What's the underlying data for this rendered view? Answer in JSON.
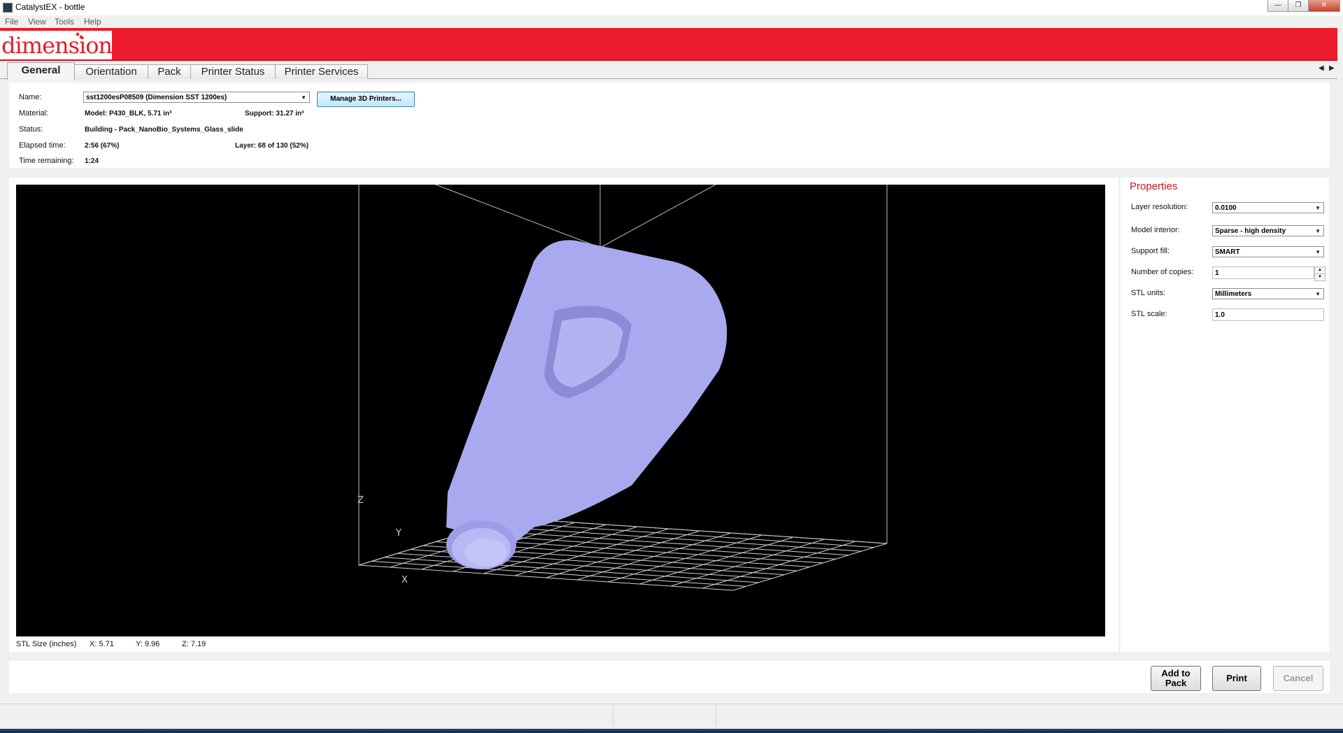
{
  "window": {
    "title": "CatalystEX - bottle"
  },
  "menu": [
    "File",
    "View",
    "Tools",
    "Help"
  ],
  "brand": {
    "logo_text": "dimension",
    "color": "#ec1c2d"
  },
  "tabs": [
    "General",
    "Orientation",
    "Pack",
    "Printer Status",
    "Printer Services"
  ],
  "info": {
    "name_label": "Name:",
    "name_value": "sst1200esP08509  (Dimension SST 1200es)",
    "manage_label": "Manage 3D Printers...",
    "material_label": "Material:",
    "model_value": "Model:  P430_BLK, 5.71 in³",
    "support_value": "Support:  31.27 in³",
    "status_label": "Status:",
    "status_value": "Building  -  Pack_NanoBio_Systems_Glass_slide",
    "elapsed_label": "Elapsed time:",
    "elapsed_value": "2:56  (67%)",
    "layer_value": "Layer:  68 of 130  (52%)",
    "remaining_label": "Time remaining:",
    "remaining_value": "1:24"
  },
  "viewport": {
    "axis_x": "X",
    "axis_y": "Y",
    "axis_z": "Z",
    "model_color": "#a9a9ef"
  },
  "stl_size": {
    "label": "STL Size (inches)",
    "x": "X:  5.71",
    "y": "Y:  9.96",
    "z": "Z:  7.19"
  },
  "properties": {
    "title": "Properties",
    "layer_resolution_label": "Layer resolution:",
    "layer_resolution_value": "0.0100",
    "model_interior_label": "Model interior:",
    "model_interior_value": "Sparse - high density",
    "support_fill_label": "Support fill:",
    "support_fill_value": "SMART",
    "copies_label": "Number of copies:",
    "copies_value": "1",
    "stl_units_label": "STL units:",
    "stl_units_value": "Millimeters",
    "stl_scale_label": "STL scale:",
    "stl_scale_value": "1.0"
  },
  "buttons": {
    "add_to_pack_line1": "Add to",
    "add_to_pack_line2": "Pack",
    "print": "Print",
    "cancel": "Cancel"
  }
}
